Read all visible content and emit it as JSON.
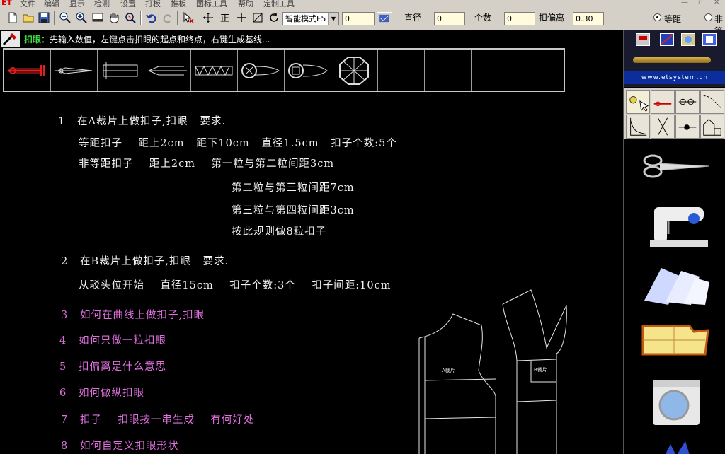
{
  "menu": {
    "logo": "ET",
    "items": [
      "文件",
      "编辑",
      "显示",
      "检测",
      "设置",
      "打板",
      "推板",
      "图标工具",
      "帮助",
      "定制工具"
    ]
  },
  "toolbar": {
    "mode_select": "智能模式F5",
    "value_field": "0",
    "diameter_label": "直径",
    "diameter_value": "0",
    "count_label": "个数",
    "count_value": "0",
    "offset_label": "扣偏离",
    "offset_value": "0.30",
    "radio_equal": "等距",
    "radio_unequal": "非等"
  },
  "hint": {
    "title": "扣眼：",
    "text": "先输入数值，左键点击扣眼的起点和终点，右键生成基线..."
  },
  "sidebar": {
    "url": "www.etsystem.cn"
  },
  "content": {
    "l1": "1   在A裁片上做扣子,扣眼   要求.",
    "l1a": "等距扣子    距上2cm   距下10cm   直径1.5cm   扣子个数:5个",
    "l1b": "非等距扣子    距上2cm    第一粒与第二粒间距3cm",
    "l1c": "第二粒与第三粒间距7cm",
    "l1d": "第三粒与第四粒间距3cm",
    "l1e": "按此规则做8粒扣子",
    "l2": "2   在B裁片上做扣子,扣眼   要求.",
    "l2a": "从驳头位开始    直径15cm    扣子个数:3个    扣子间距:10cm",
    "l3": "3   如何在曲线上做扣子,扣眼",
    "l4": "4   如何只做一粒扣眼",
    "l5": "5   扣偏离是什么意思",
    "l6": "6   如何做纵扣眼",
    "l7": "7   扣子    扣眼按一串生成    有何好处",
    "l8": "8   如何自定义扣眼形状"
  },
  "pattern": {
    "a_label": "A裁片",
    "b_label": "B裁片"
  }
}
